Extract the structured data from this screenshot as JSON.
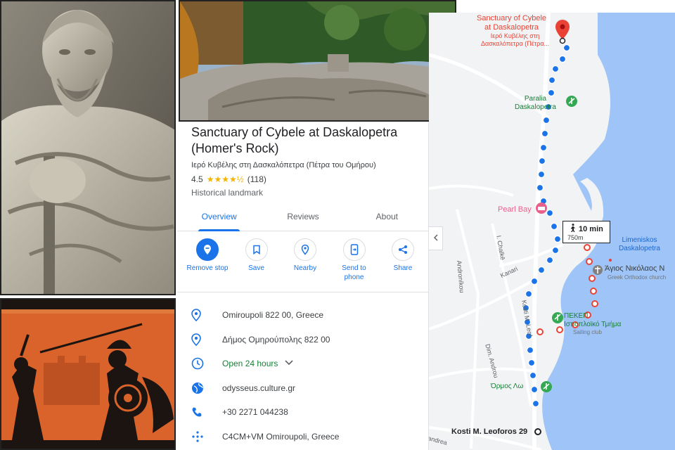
{
  "place": {
    "title": "Sanctuary of Cybele at Daskalopetra (Homer's Rock)",
    "subtitle": "Ιερό Κυβέλης στη Δασκαλόπετρα (Πέτρα του Ομήρου)",
    "rating": "4.5",
    "stars": "★★★★½",
    "reviews_count": "(118)",
    "category": "Historical landmark"
  },
  "tabs": [
    "Overview",
    "Reviews",
    "About"
  ],
  "actions": {
    "remove_stop": "Remove stop",
    "save": "Save",
    "nearby": "Nearby",
    "send_to_phone_1": "Send to",
    "send_to_phone_2": "phone",
    "share": "Share"
  },
  "info": {
    "address": "Omiroupoli 822 00, Greece",
    "address_greek": "Δήμος Ομηρούπολης 822 00",
    "hours": "Open 24 hours",
    "website": "odysseus.culture.gr",
    "phone": "+30 2271 044238",
    "plus_code": "C4CM+VM Omiroupoli, Greece"
  },
  "map": {
    "destination_line1": "Sanctuary of Cybele",
    "destination_line2": "at Daskalopetra",
    "destination_greek_1": "Ιερό Κυβέλης στη",
    "destination_greek_2": "Δασκαλόπετρα (Πέτρα...",
    "beach_1": "Paralia",
    "beach_2": "Daskalopetra",
    "hotel": "Pearl Bay",
    "duration": "10 min",
    "distance": "750m",
    "harbor_1": "Limeniskos",
    "harbor_2": "Daskalopetra",
    "church": "Άγιος Νικόλαος Ν",
    "church_sub": "Greek Orthodox church",
    "museum_1": "ΠΕΚΕΠ",
    "museum_2": "Ιστιοπλοϊκό Τμήμα",
    "museum_sub": "Sailing club",
    "beach_south": "Όρμος Λω",
    "start": "Kosti M. Leoforos 29",
    "street_1": "Androníkou",
    "street_2": "I. Chalkē",
    "street_3": "Kanari",
    "street_4": "Dim. Androu",
    "street_5": "Kosti M. Leof",
    "street_6": "andrea"
  },
  "colors": {
    "accent": "#1a73e8",
    "open_green": "#188038",
    "route_blue": "#1a73e8",
    "pin_red": "#ea4335",
    "sea": "#9fc4f7",
    "hotel_pink": "#e8608b",
    "park_green": "#34a853"
  }
}
